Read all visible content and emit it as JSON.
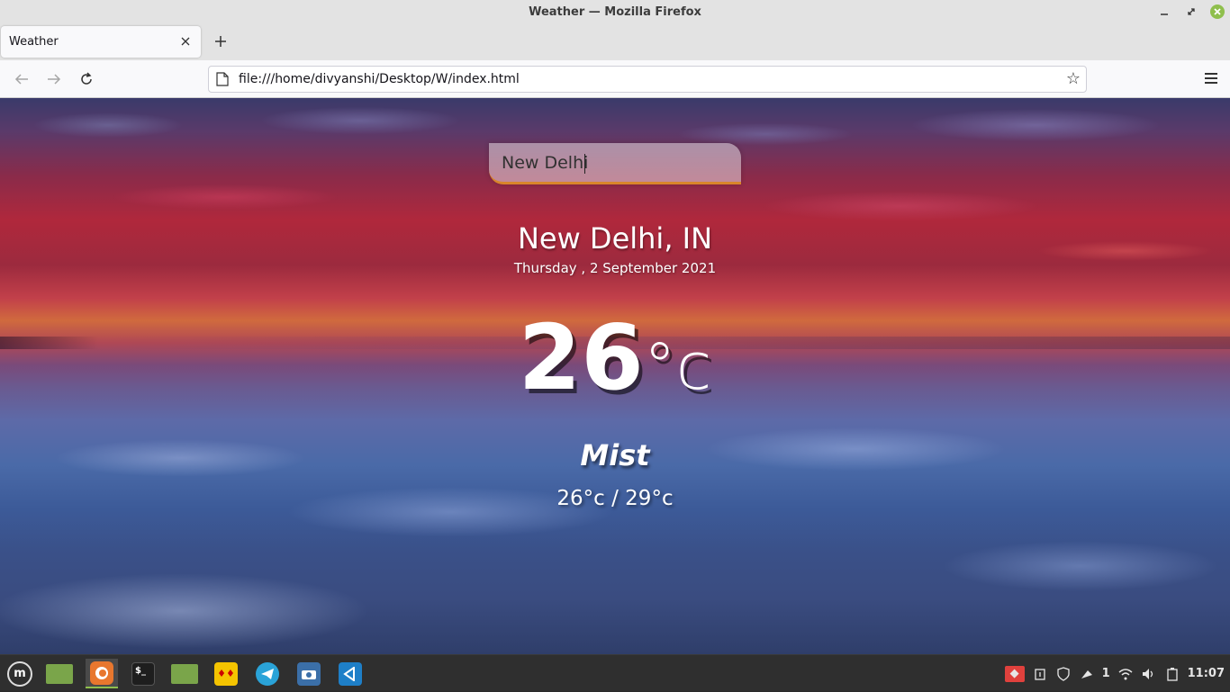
{
  "window": {
    "title": "Weather — Mozilla Firefox"
  },
  "browser": {
    "tab_label": "Weather",
    "url": "file:///home/divyanshi/Desktop/W/index.html"
  },
  "app": {
    "search_value": "New Delhi",
    "city": "New Delhi, IN",
    "date": "Thursday , 2 September 2021",
    "temp_value": "26",
    "temp_unit": "°c",
    "condition": "Mist",
    "hi_lo": "26°c / 29°c"
  },
  "taskbar": {
    "items": [
      "menu-icon",
      "files-icon",
      "firefox-icon",
      "terminal-icon",
      "folder-icon",
      "app-icon",
      "telegram-icon",
      "screenshot-icon",
      "vscode-icon"
    ],
    "tray_notification_count": "1",
    "clock": "11:07"
  },
  "colors": {
    "accent": "#d9852a",
    "taskbar_bg": "#2f2f2f",
    "mint_green": "#8fbf4d"
  }
}
